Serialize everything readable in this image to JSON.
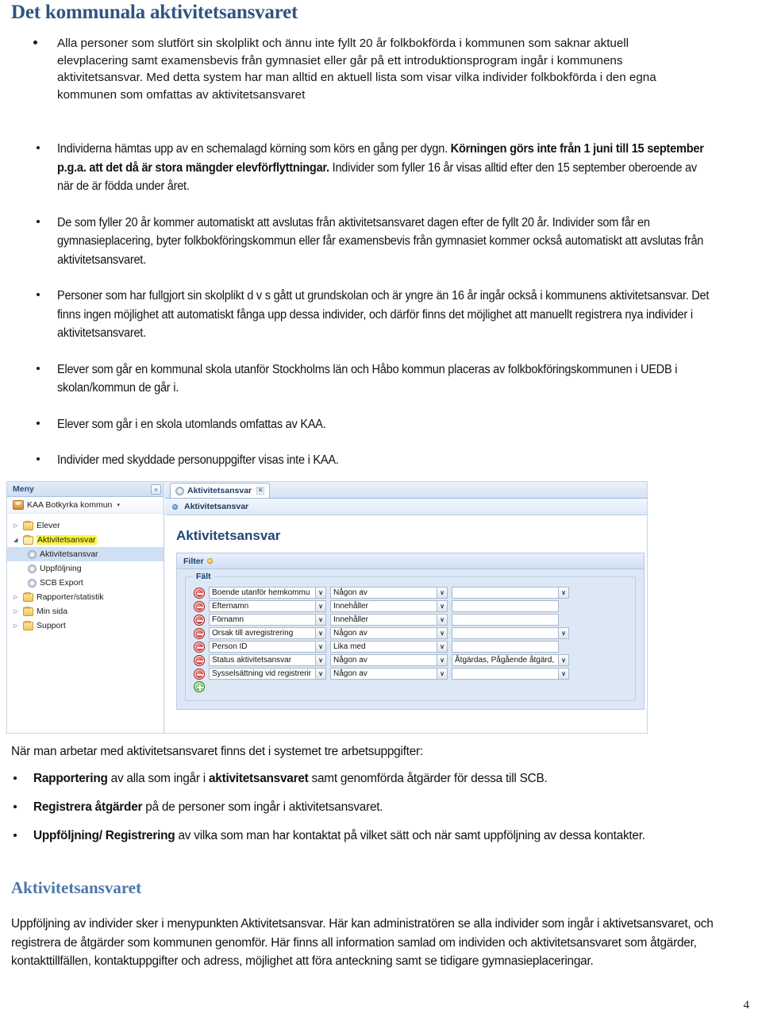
{
  "document": {
    "title": "Det kommunala aktivitetsansvaret",
    "page_number": "4"
  },
  "intro_bullets": [
    "Alla personer som slutfört sin skolplikt och ännu inte fyllt 20 år folkbokförda i kommunen som saknar aktuell elevplacering samt examensbevis från gymnasiet eller går på ett introduktionsprogram ingår i kommunens aktivitetsansvar. Med detta system har man alltid en aktuell lista som visar vilka individer folkbokförda i den egna kommunen som omfattas av aktivitetsansvaret"
  ],
  "narrow_bullets": [
    {
      "segments": [
        {
          "text": "Individerna hämtas upp av en schemalagd körning som körs en gång per dygn. ",
          "bold": false
        },
        {
          "text": "Körningen görs inte från 1 juni till 15 september p.g.a. att det då är stora mängder elevförflyttningar.",
          "bold": true
        },
        {
          "text": " Individer som fyller 16 år visas alltid efter den 15 september oberoende av när de är födda under året.",
          "bold": false
        }
      ]
    },
    {
      "segments": [
        {
          "text": "De som fyller 20 år kommer automatiskt att avslutas från aktivitetsansvaret dagen efter de fyllt 20 år. Individer som får en gymnasieplacering, byter folkbokföringskommun eller får examensbevis från gymnasiet kommer också automatiskt att avslutas från aktivitetsansvaret.",
          "bold": false
        }
      ]
    },
    {
      "segments": [
        {
          "text": "Personer som har fullgjort sin skolplikt d v s gått ut grundskolan och är yngre än 16 år ingår också i kommunens aktivitetsansvar. Det finns ingen möjlighet att automatiskt fånga upp dessa individer, och därför finns det möjlighet att manuellt registrera nya individer i aktivitetsansvaret.",
          "bold": false
        }
      ]
    },
    {
      "segments": [
        {
          "text": "Elever som går en kommunal skola utanför Stockholms län och Håbo kommun placeras av folkbokföringskommunen i UEDB i skolan/kommun de går i.",
          "bold": false
        }
      ]
    },
    {
      "segments": [
        {
          "text": "Elever som går i en skola utomlands omfattas av KAA.",
          "bold": false
        }
      ]
    },
    {
      "segments": [
        {
          "text": "Individer med skyddade personuppgifter visas inte i KAA.",
          "bold": false
        }
      ]
    }
  ],
  "screenshot": {
    "menu": {
      "header": "Meny",
      "collapse_icon": "«",
      "account": "KAA Botkyrka kommun",
      "account_caret": "▾",
      "tree": [
        {
          "label": "Elever",
          "level": 1,
          "type": "folder",
          "expanded": false,
          "selected": false,
          "highlighted": false
        },
        {
          "label": "Aktivitetsansvar",
          "level": 1,
          "type": "folder",
          "expanded": true,
          "selected": false,
          "highlighted": true
        },
        {
          "label": "Aktivitetsansvar",
          "level": 2,
          "type": "item",
          "expanded": false,
          "selected": true,
          "highlighted": false
        },
        {
          "label": "Uppföljning",
          "level": 2,
          "type": "item",
          "expanded": false,
          "selected": false,
          "highlighted": false
        },
        {
          "label": "SCB Export",
          "level": 2,
          "type": "item",
          "expanded": false,
          "selected": false,
          "highlighted": false
        },
        {
          "label": "Rapporter/statistik",
          "level": 1,
          "type": "folder",
          "expanded": false,
          "selected": false,
          "highlighted": false
        },
        {
          "label": "Min sida",
          "level": 1,
          "type": "folder",
          "expanded": false,
          "selected": false,
          "highlighted": false
        },
        {
          "label": "Support",
          "level": 1,
          "type": "folder",
          "expanded": false,
          "selected": false,
          "highlighted": false
        }
      ]
    },
    "tab": {
      "label": "Aktivitetsansvar",
      "close_icon": "✕"
    },
    "breadcrumb": "Aktivitetsansvar",
    "heading": "Aktivitetsansvar",
    "filter": {
      "legend": "Filter",
      "fieldset_legend": "Fält",
      "add_row_label": "+",
      "remove_row_label": "−",
      "rows": [
        {
          "field": "Boende utanför hemkommu",
          "operator": "Någon av",
          "value": "",
          "value_type": "combo"
        },
        {
          "field": "Efternamn",
          "operator": "Innehåller",
          "value": "",
          "value_type": "text"
        },
        {
          "field": "Förnamn",
          "operator": "Innehåller",
          "value": "",
          "value_type": "text"
        },
        {
          "field": "Orsak till avregistrering",
          "operator": "Någon av",
          "value": "",
          "value_type": "combo"
        },
        {
          "field": "Person ID",
          "operator": "Lika med",
          "value": "",
          "value_type": "text"
        },
        {
          "field": "Status aktivitetsansvar",
          "operator": "Någon av",
          "value": "Åtgärdas, Pågående åtgärd,",
          "value_type": "combo"
        },
        {
          "field": "Sysselsättning vid registrerir",
          "operator": "Någon av",
          "value": "",
          "value_type": "combo"
        }
      ]
    }
  },
  "mid": {
    "lead": "När man arbetar med aktivitetsansvaret finns det i systemet tre arbetsuppgifter:",
    "bullets": [
      {
        "segments": [
          {
            "text": "Rapportering",
            "bold": true
          },
          {
            "text": " av alla som ingår i ",
            "bold": false
          },
          {
            "text": "aktivitetsansvaret",
            "bold": true
          },
          {
            "text": " samt genomförda åtgärder för dessa till SCB.",
            "bold": false
          }
        ]
      },
      {
        "segments": [
          {
            "text": "Registrera åtgärder",
            "bold": true
          },
          {
            "text": " på de personer som ingår i aktivitetsansvaret.",
            "bold": false
          }
        ]
      },
      {
        "segments": [
          {
            "text": "Uppföljning/ Registrering",
            "bold": true
          },
          {
            "text": " av vilka som man har kontaktat på vilket sätt och när samt uppföljning av dessa kontakter.",
            "bold": false
          }
        ]
      }
    ]
  },
  "section": {
    "heading": "Aktivitetsansvaret",
    "body": "Uppföljning av individer sker i menypunkten Aktivitetsansvar. Här kan administratören se alla individer som ingår i aktivetsansvaret, och registrera de åtgärder som kommunen genomför. Här finns all information samlad om individen och aktivitetsansvaret som åtgärder, kontakttillfällen, kontaktuppgifter och adress, möjlighet att föra anteckning samt se tidigare gymnasieplaceringar."
  },
  "colors": {
    "title_blue": "#2f5480",
    "section_blue": "#4a77ab",
    "app_blue": "#21467a",
    "highlight_yellow": "#fbf43c"
  }
}
